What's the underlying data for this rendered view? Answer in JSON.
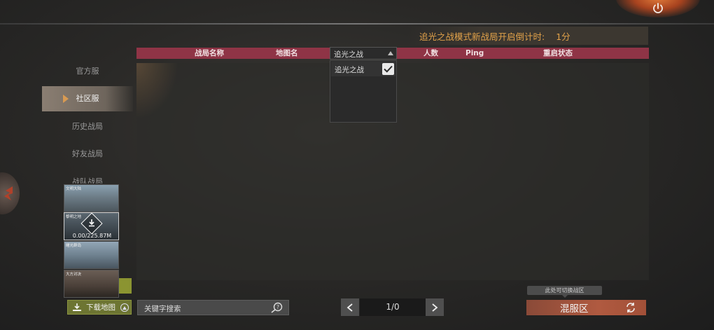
{
  "countdown": {
    "label": "追光之战模式新战局开启倒计时:",
    "value": "1分"
  },
  "table": {
    "headers": {
      "name": "战局名称",
      "map": "地图名",
      "players": "人数",
      "ping": "Ping",
      "restart": "重启状态"
    },
    "mode_filter": {
      "selected": "追光之战",
      "options": [
        {
          "label": "追光之战",
          "checked": true
        }
      ]
    }
  },
  "sidebar": {
    "items": [
      {
        "label": "官方服",
        "active": false
      },
      {
        "label": "社区服",
        "active": true
      },
      {
        "label": "历史战局",
        "active": false
      },
      {
        "label": "好友战局",
        "active": false
      },
      {
        "label": "战队战局",
        "active": false
      }
    ]
  },
  "maps": [
    {
      "name": "文明大陆"
    },
    {
      "name": "黎明之地",
      "progress": "0.00/225.87M"
    },
    {
      "name": "曙光群岛"
    },
    {
      "name": "大方对决"
    }
  ],
  "download_map": {
    "label": "下载地图"
  },
  "search": {
    "placeholder": "关键字搜索"
  },
  "pagination": {
    "label": "1/0"
  },
  "zone": {
    "tooltip": "此处可切换战区",
    "label": "混服区"
  },
  "colors": {
    "accent": "#8f3446",
    "countdown": "#e2a24a",
    "zone": "#b05a40",
    "download": "#6d7532"
  }
}
